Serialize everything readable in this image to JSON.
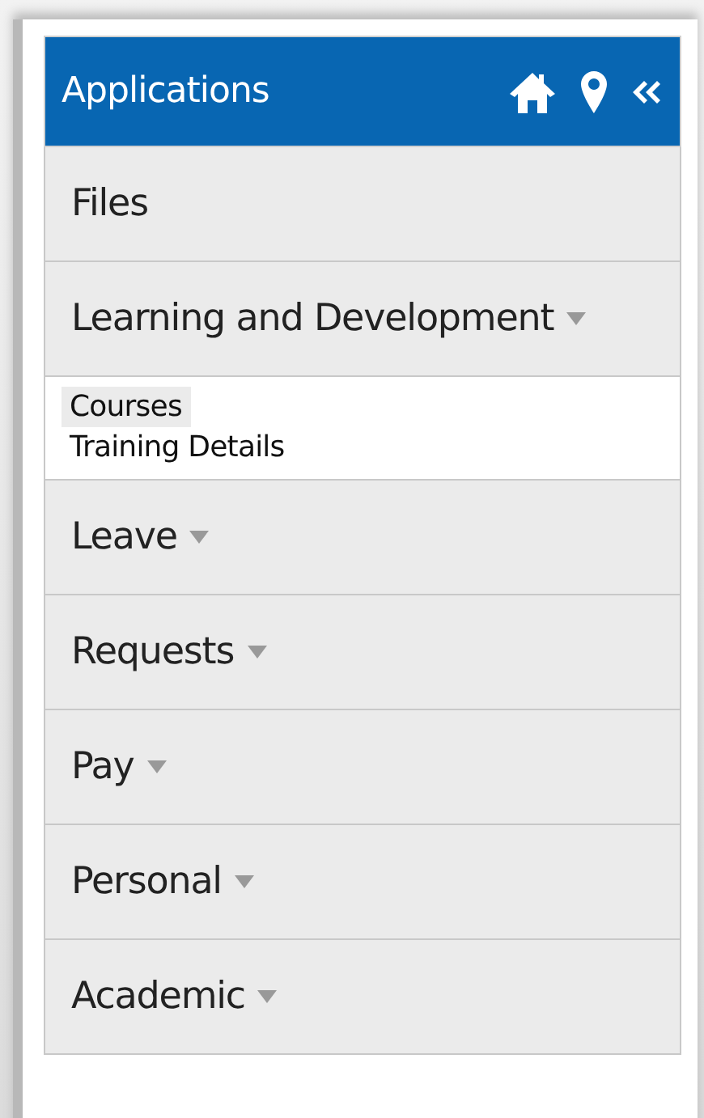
{
  "header": {
    "title": "Applications"
  },
  "menu": [
    {
      "kind": "link",
      "label": "Files"
    },
    {
      "kind": "group",
      "label": "Learning and Development",
      "children": [
        {
          "label": "Courses",
          "selected": true
        },
        {
          "label": "Training Details",
          "selected": false
        }
      ]
    },
    {
      "kind": "group",
      "label": "Leave"
    },
    {
      "kind": "group",
      "label": "Requests"
    },
    {
      "kind": "group",
      "label": "Pay"
    },
    {
      "kind": "group",
      "label": "Personal"
    },
    {
      "kind": "group",
      "label": "Academic"
    }
  ]
}
